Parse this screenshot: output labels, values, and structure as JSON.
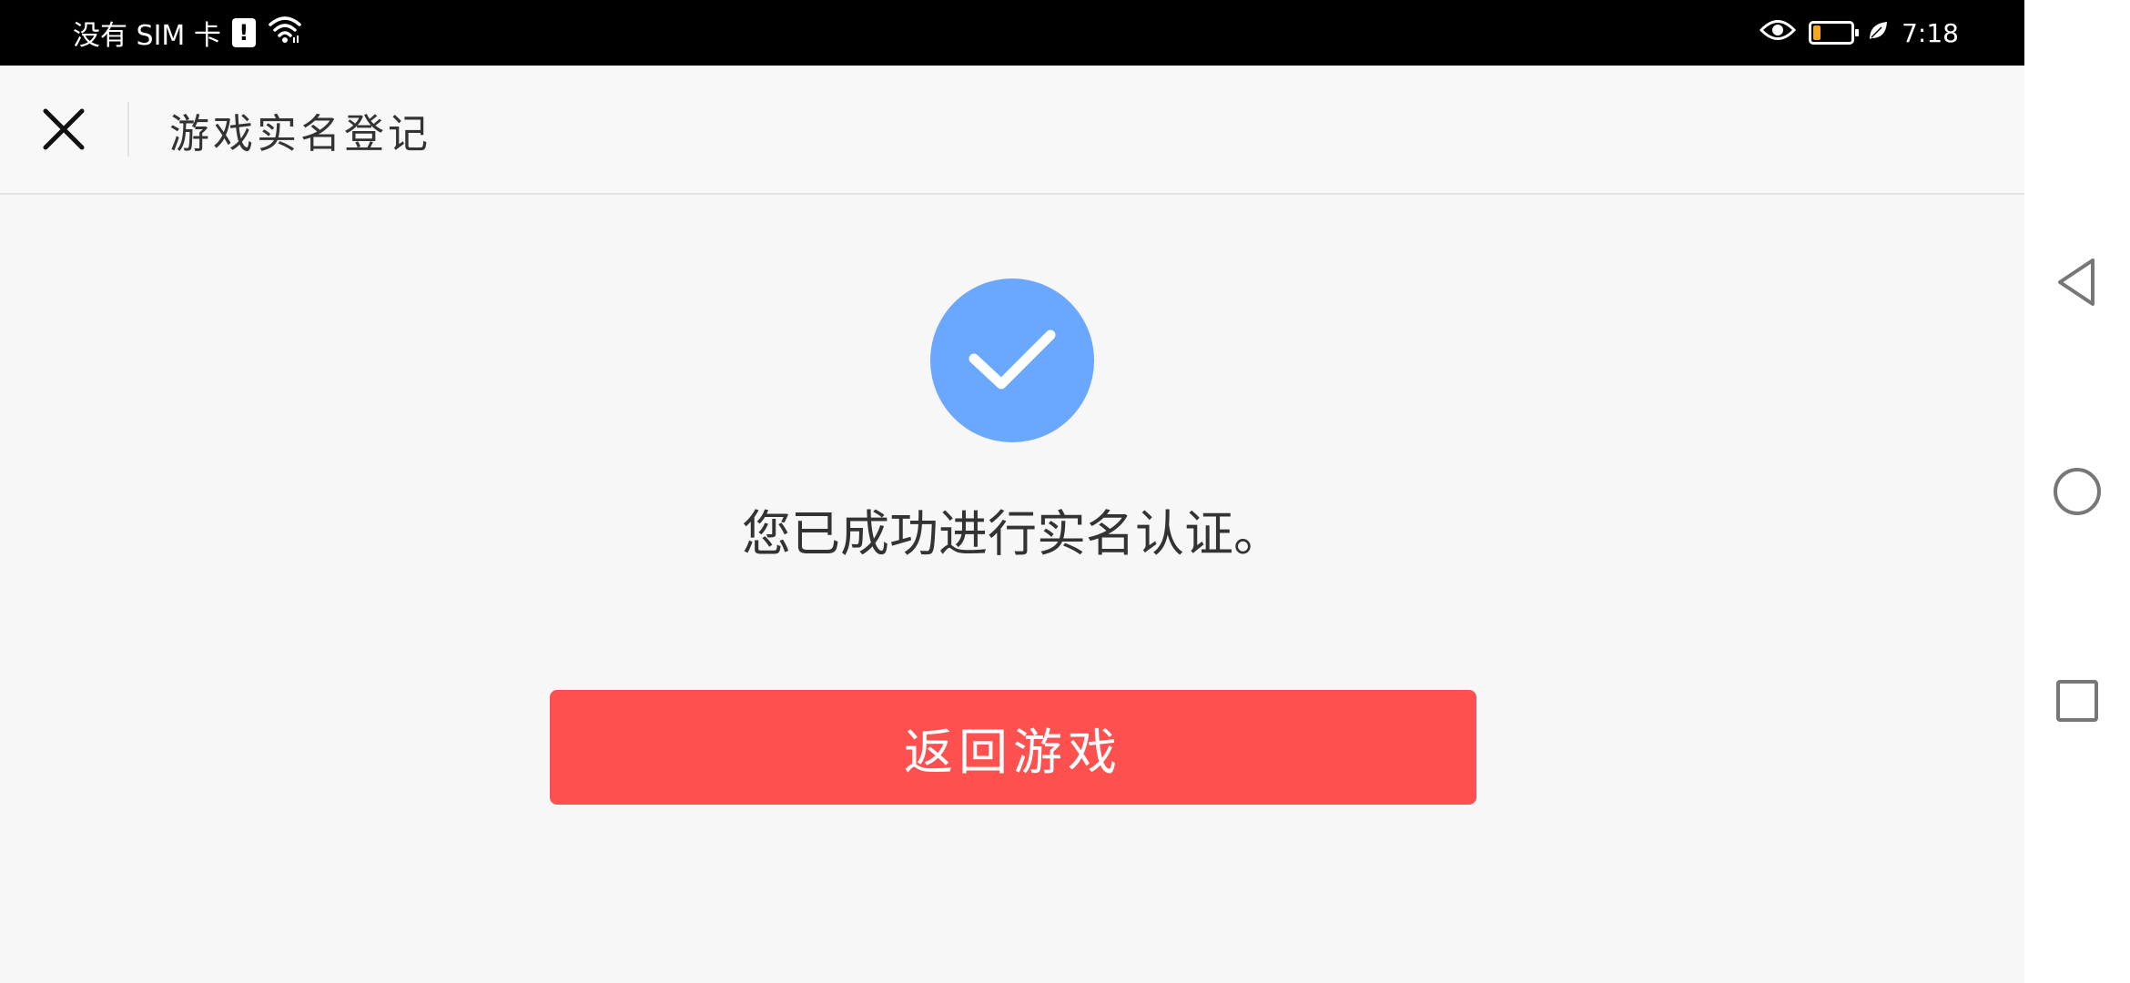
{
  "status_bar": {
    "carrier": "没有 SIM 卡",
    "sim_alert": "!",
    "time": "7:18"
  },
  "header": {
    "title": "游戏实名登记"
  },
  "main": {
    "success_message": "您已成功进行实名认证。",
    "return_button_label": "返回游戏"
  },
  "colors": {
    "check_circle": "#6aa7ff",
    "primary_button": "#ff5050",
    "battery_level": "#f5a623"
  },
  "icons": {
    "close": "close-icon",
    "check": "check-icon",
    "nav_back": "back-triangle-icon",
    "nav_home": "home-circle-icon",
    "nav_recents": "recents-square-icon"
  }
}
